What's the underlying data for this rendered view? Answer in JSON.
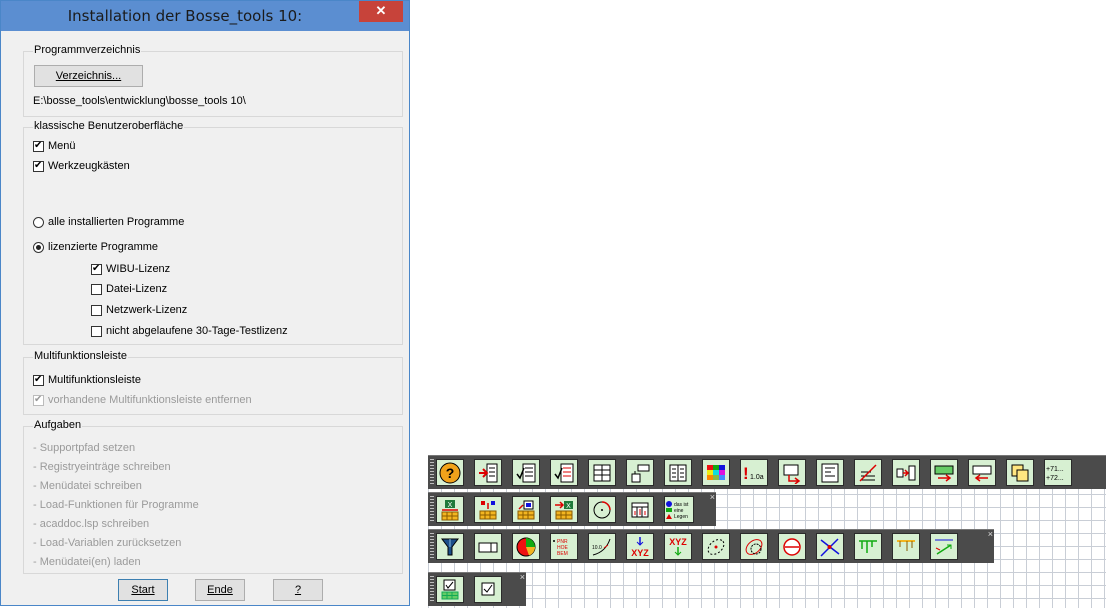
{
  "dialog": {
    "title": "Installation der Bosse_tools 10:",
    "close_label": "✕",
    "program_dir": {
      "group_label": "Programmverzeichnis",
      "button_label": "Verzeichnis...",
      "path": "E:\\bosse_tools\\entwicklung\\bosse_tools 10\\"
    },
    "classic_ui": {
      "group_label": "klassische Benutzeroberfläche",
      "menu": {
        "label": "Menü",
        "checked": true
      },
      "toolboxes": {
        "label": "Werkzeugkästen",
        "checked": true
      },
      "radio_all": {
        "label": "alle installierten Programme",
        "selected": false
      },
      "radio_licensed": {
        "label": "lizenzierte Programme",
        "selected": true
      },
      "licenses": [
        {
          "label": "WIBU-Lizenz",
          "checked": true
        },
        {
          "label": "Datei-Lizenz",
          "checked": false
        },
        {
          "label": "Netzwerk-Lizenz",
          "checked": false
        },
        {
          "label": "nicht abgelaufene 30-Tage-Testlizenz",
          "checked": false
        }
      ]
    },
    "ribbon": {
      "group_label": "Multifunktionsleiste",
      "ribbon_checkbox": {
        "label": "Multifunktionsleiste",
        "checked": true
      },
      "remove_checkbox": {
        "label": "vorhandene Multifunktionsleiste entfernen",
        "checked": true,
        "disabled": true
      }
    },
    "tasks": {
      "group_label": "Aufgaben",
      "items": [
        "- Supportpfad setzen",
        "- Registryeinträge schreiben",
        "- Menüdatei schreiben",
        "- Load-Funktionen für Programme",
        "- acaddoc.lsp schreiben",
        "- Load-Variablen zurücksetzen",
        "- Menüdatei(en) laden"
      ]
    },
    "buttons": {
      "start": "Start",
      "end": "Ende",
      "help": "?"
    }
  },
  "toolbars": {
    "close_glyph": "×",
    "row1_icons": [
      "help-icon",
      "insert-text-icon",
      "check-list-icon",
      "check-text-icon",
      "table-select-icon",
      "layout-icon",
      "columns-icon",
      "color-palette-icon",
      "number-format-icon",
      "arrow-frame-icon",
      "align-left-icon",
      "strike-text-icon",
      "move-block-icon",
      "arrow-right-box-icon",
      "arrow-left-box-icon",
      "copy-icon",
      "number-sum-icon"
    ],
    "row1_texts": {
      "number_format": "1.0a",
      "sum_top": "+71...",
      "sum_bottom": "+72..."
    },
    "row2_icons": [
      "excel-import-icon",
      "table-insert-icon",
      "table-color-icon",
      "excel-export-icon",
      "circle-arc-icon",
      "column-marks-icon",
      "legend-icon"
    ],
    "row2_texts": {
      "legend_1": "das ist",
      "legend_2": "eine",
      "legend_3": "Legen"
    },
    "row3_icons": [
      "filter-icon",
      "rectangle-icon",
      "pie-chart-icon",
      "point-labels-icon",
      "dimension-arc-icon",
      "xyz-coordinate-icon",
      "xyz-export-icon",
      "ellipse-icon",
      "intersect-icon",
      "no-entry-icon",
      "intersection-icon",
      "profile-icon",
      "section-icon",
      "scale-arrow-icon"
    ],
    "row3_texts": {
      "pnr": "PNR",
      "hoe": "HOE",
      "bem": "BEM",
      "value": "10.0",
      "xyz": "XYZ"
    },
    "row4_icons": [
      "checkbox-table-icon",
      "checkbox-icon"
    ]
  }
}
